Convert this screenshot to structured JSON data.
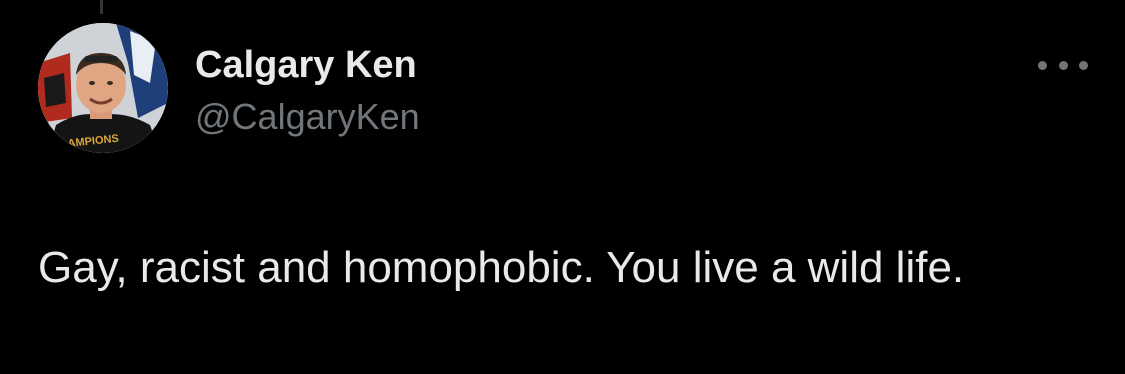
{
  "tweet": {
    "author": {
      "display_name": "Calgary Ken",
      "handle": "@CalgaryKen",
      "avatar_icon": "profile-photo-avatar"
    },
    "more_icon": "more-horizontal-icon",
    "text": "Gay, racist and homophobic. You live a wild life."
  },
  "colors": {
    "background": "#000000",
    "primary_text": "#e7e9ea",
    "secondary_text": "#71767b",
    "thread_line": "#333639"
  }
}
